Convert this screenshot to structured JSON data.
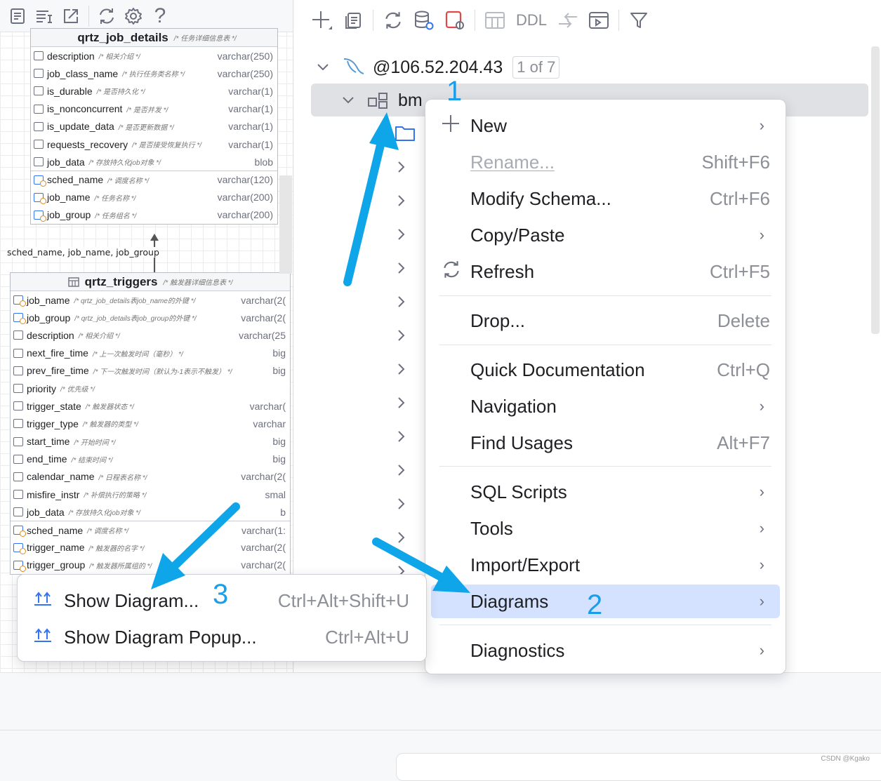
{
  "left_toolbar": {
    "icons": [
      "document-icon",
      "text-format-icon",
      "export-icon",
      "refresh-icon",
      "settings-icon",
      "help-icon"
    ]
  },
  "diagram": {
    "table1": {
      "name": "qrtz_job_details",
      "comment": "/* 任务详细信息表 */",
      "columns": [
        {
          "name": "description",
          "comment": "/* 相关介绍 */",
          "type": "varchar(250)",
          "key": false
        },
        {
          "name": "job_class_name",
          "comment": "/* 执行任务类名称 */",
          "type": "varchar(250)",
          "key": false
        },
        {
          "name": "is_durable",
          "comment": "/* 是否持久化 */",
          "type": "varchar(1)",
          "key": false
        },
        {
          "name": "is_nonconcurrent",
          "comment": "/* 是否并发 */",
          "type": "varchar(1)",
          "key": false
        },
        {
          "name": "is_update_data",
          "comment": "/* 是否更新数据 */",
          "type": "varchar(1)",
          "key": false
        },
        {
          "name": "requests_recovery",
          "comment": "/* 是否接受恢复执行 */",
          "type": "varchar(1)",
          "key": false
        },
        {
          "name": "job_data",
          "comment": "/* 存放持久化job对象 */",
          "type": "blob",
          "key": false
        },
        {
          "name": "sched_name",
          "comment": "/* 调度名称 */",
          "type": "varchar(120)",
          "key": true
        },
        {
          "name": "job_name",
          "comment": "/* 任务名称 */",
          "type": "varchar(200)",
          "key": true
        },
        {
          "name": "job_group",
          "comment": "/* 任务组名 */",
          "type": "varchar(200)",
          "key": true
        }
      ]
    },
    "relation_label": "sched_name, job_name, job_group",
    "table2": {
      "name": "qrtz_triggers",
      "comment": "/* 触发器详细信息表 */",
      "columns": [
        {
          "name": "job_name",
          "comment": "/* qrtz_job_details表job_name的外键 */",
          "type": "varchar(2(",
          "key": true
        },
        {
          "name": "job_group",
          "comment": "/* qrtz_job_details表job_group的外键 */",
          "type": "varchar(2(",
          "key": true
        },
        {
          "name": "description",
          "comment": "/* 相关介绍 */",
          "type": "varchar(25",
          "key": false
        },
        {
          "name": "next_fire_time",
          "comment": "/* 上一次触发时间（毫秒） */",
          "type": "big",
          "key": false
        },
        {
          "name": "prev_fire_time",
          "comment": "/* 下一次触发时间（默认为-1表示不触发） */",
          "type": "big",
          "key": false
        },
        {
          "name": "priority",
          "comment": "/* 优先级 */",
          "type": "",
          "key": false
        },
        {
          "name": "trigger_state",
          "comment": "/* 触发器状态 */",
          "type": "varchar(",
          "key": false
        },
        {
          "name": "trigger_type",
          "comment": "/* 触发器的类型 */",
          "type": "varchar",
          "key": false
        },
        {
          "name": "start_time",
          "comment": "/* 开始时间 */",
          "type": "big",
          "key": false
        },
        {
          "name": "end_time",
          "comment": "/* 结束时间 */",
          "type": "big",
          "key": false
        },
        {
          "name": "calendar_name",
          "comment": "/* 日程表名称 */",
          "type": "varchar(2(",
          "key": false
        },
        {
          "name": "misfire_instr",
          "comment": "/* 补偿执行的策略 */",
          "type": "smal",
          "key": false
        },
        {
          "name": "job_data",
          "comment": "/* 存放持久化job对象 */",
          "type": "b",
          "key": false
        },
        {
          "name": "sched_name",
          "comment": "/* 调度名称 */",
          "type": "varchar(1:",
          "key": true
        },
        {
          "name": "trigger_name",
          "comment": "/* 触发器的名字 */",
          "type": "varchar(2(",
          "key": true
        },
        {
          "name": "trigger_group",
          "comment": "/* 触发器所属组的 */",
          "type": "varchar(2(",
          "key": true
        }
      ]
    }
  },
  "right_toolbar": {
    "ddl_label": "DDL"
  },
  "tree": {
    "host": "@106.52.204.43",
    "host_badge": "1 of 7",
    "schema": "bm"
  },
  "context_menu": {
    "items": [
      {
        "label": "New",
        "shortcut": "",
        "submenu": true
      },
      {
        "label": "Rename...",
        "shortcut": "Shift+F6",
        "submenu": false,
        "disabled": true
      },
      {
        "label": "Modify Schema...",
        "shortcut": "Ctrl+F6",
        "submenu": false
      },
      {
        "label": "Copy/Paste",
        "shortcut": "",
        "submenu": true
      },
      {
        "label": "Refresh",
        "shortcut": "Ctrl+F5",
        "submenu": false
      },
      {
        "label": "Drop...",
        "shortcut": "Delete",
        "submenu": false
      },
      {
        "label": "Quick Documentation",
        "shortcut": "Ctrl+Q",
        "submenu": false
      },
      {
        "label": "Navigation",
        "shortcut": "",
        "submenu": true
      },
      {
        "label": "Find Usages",
        "shortcut": "Alt+F7",
        "submenu": false
      },
      {
        "label": "SQL Scripts",
        "shortcut": "",
        "submenu": true
      },
      {
        "label": "Tools",
        "shortcut": "",
        "submenu": true
      },
      {
        "label": "Import/Export",
        "shortcut": "",
        "submenu": true
      },
      {
        "label": "Diagrams",
        "shortcut": "",
        "submenu": true,
        "selected": true
      },
      {
        "label": "Diagnostics",
        "shortcut": "",
        "submenu": true
      }
    ]
  },
  "submenu": {
    "items": [
      {
        "label": "Show Diagram...",
        "shortcut": "Ctrl+Alt+Shift+U"
      },
      {
        "label": "Show Diagram Popup...",
        "shortcut": "Ctrl+Alt+U"
      }
    ]
  },
  "annotations": {
    "step1": "1",
    "step2": "2",
    "step3": "3",
    "arrow_color": "#0ea5e9"
  },
  "watermark": "CSDN @Kgako",
  "colors": {
    "accent": "#3574f0",
    "selection": "#d4e2ff"
  }
}
